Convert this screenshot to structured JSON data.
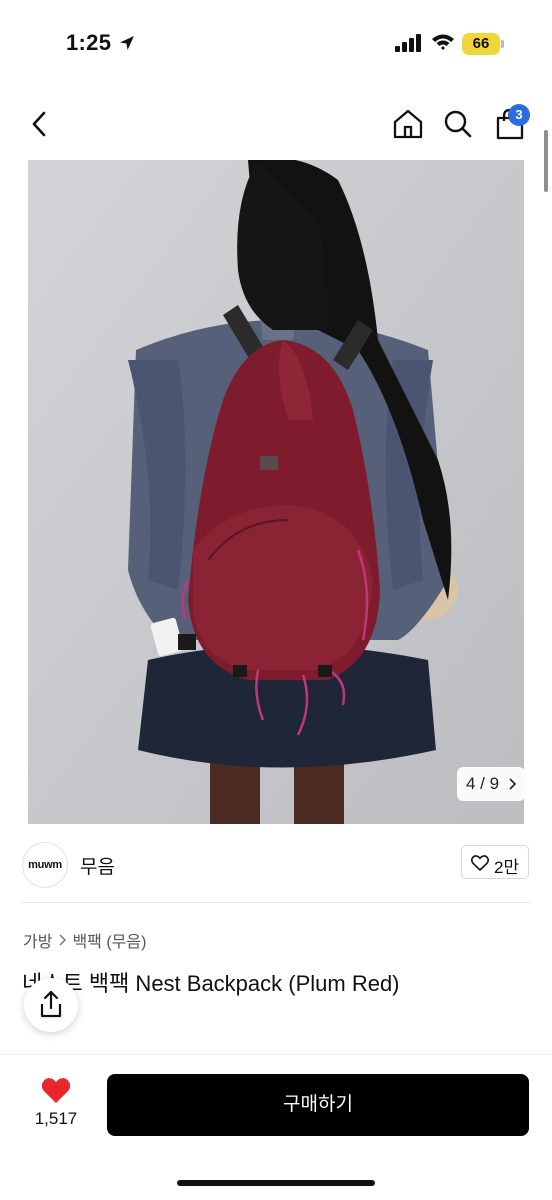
{
  "status_bar": {
    "time": "1:25",
    "battery": "66"
  },
  "nav": {
    "cart_count": "3",
    "icons": [
      "back-chevron-icon",
      "home-icon",
      "search-icon",
      "shopping-bag-icon"
    ]
  },
  "image": {
    "counter": "4 / 9"
  },
  "brand": {
    "logo_text": "muwm",
    "name": "무음",
    "like_count": "2만"
  },
  "breadcrumb": {
    "level1": "가방",
    "level2": "백팩 (무음)"
  },
  "product": {
    "title": "네스트 백팩 Nest Backpack (Plum Red)"
  },
  "bottom": {
    "wish_count": "1,517",
    "buy_label": "구매하기"
  },
  "colors": {
    "accent_badge": "#2c6be0",
    "heart": "#e8262b",
    "buy_button": "#000000",
    "battery": "#f1d63b"
  }
}
